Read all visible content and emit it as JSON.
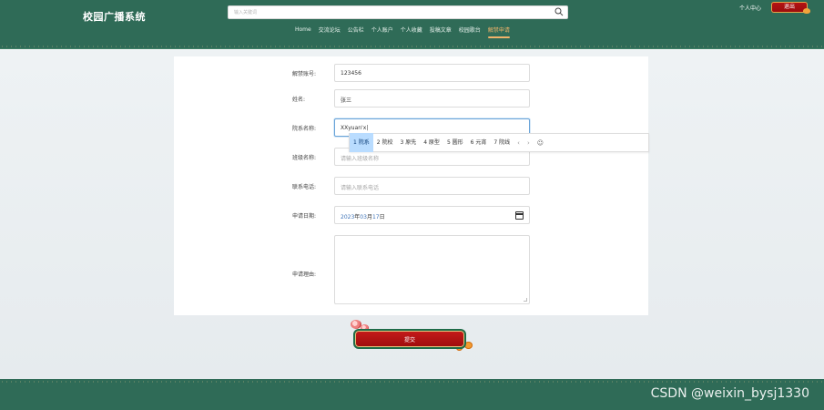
{
  "header": {
    "brand": "校园广播系统",
    "search_placeholder": "输入关键词",
    "nav": [
      "Home",
      "交流论坛",
      "公告栏",
      "个人账户",
      "个人收藏",
      "投稿文章",
      "校园歌台",
      "解禁申请"
    ],
    "active_nav_index": 7,
    "user_center": "个人中心",
    "logout": "退出"
  },
  "form": {
    "account_label": "解禁账号:",
    "account_value": "123456",
    "name_label": "姓名:",
    "name_value": "张三",
    "dept_label": "院系名称:",
    "dept_value": "XXyuan'x|",
    "class_label": "班级名称:",
    "class_placeholder": "请输入班级名称",
    "phone_label": "联系电话:",
    "phone_placeholder": "请输入联系电话",
    "date_label": "申请日期:",
    "date": {
      "y": "2023",
      "y_suffix": "年",
      "m": "03",
      "m_suffix": "月",
      "d": "17",
      "d_suffix": "日"
    },
    "reason_label": "申请理由:"
  },
  "ime": {
    "candidates": [
      "1 院系",
      "2 院校",
      "3 原先",
      "4 原型",
      "5 圆形",
      "6 元宵",
      "7 院线"
    ],
    "selected_index": 0,
    "prev": "‹",
    "next": "›",
    "emoji": "☺"
  },
  "submit_label": "提交",
  "watermark": "CSDN @weixin_bysj1330",
  "colors": {
    "header": "#2f6b57",
    "accent": "#f0b36a",
    "submit": "#c51a1a",
    "ime_select": "#b9dcff"
  }
}
